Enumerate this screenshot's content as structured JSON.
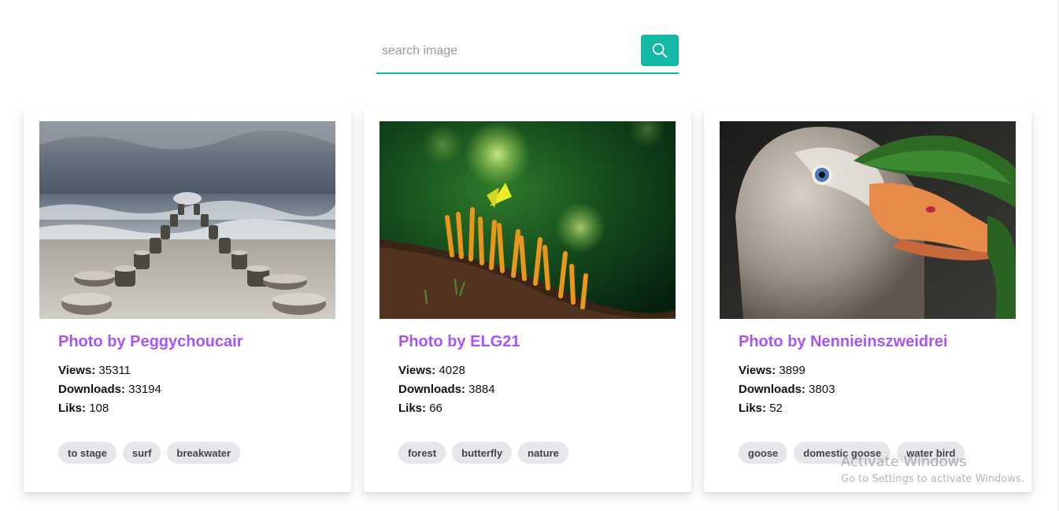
{
  "search": {
    "placeholder": "search image",
    "value": "",
    "button_icon": "search-icon",
    "accent": "#14b8a6"
  },
  "cards": [
    {
      "title": "Photo by Peggychoucair",
      "image_subject": "wooden breakwater posts leading into a stormy sea",
      "stats": {
        "views_label": "Views:",
        "views": "35311",
        "downloads_label": "Downloads:",
        "downloads": "33194",
        "likes_label": "Liks:",
        "likes": "108"
      },
      "tags": [
        "to stage",
        "surf",
        "breakwater"
      ]
    },
    {
      "title": "Photo by ELG21",
      "image_subject": "yellow butterfly on orange coral fungus in a green forest",
      "stats": {
        "views_label": "Views:",
        "views": "4028",
        "downloads_label": "Downloads:",
        "downloads": "3884",
        "likes_label": "Liks:",
        "likes": "66"
      },
      "tags": [
        "forest",
        "butterfly",
        "nature"
      ]
    },
    {
      "title": "Photo by Nennieinszweidrei",
      "image_subject": "close-up of a domestic goose head with orange beak",
      "stats": {
        "views_label": "Views:",
        "views": "3899",
        "downloads_label": "Downloads:",
        "downloads": "3803",
        "likes_label": "Liks:",
        "likes": "52"
      },
      "tags": [
        "goose",
        "domestic goose",
        "water bird"
      ]
    }
  ],
  "colors": {
    "title": "#a855f7",
    "tag_bg": "#e5e7eb"
  },
  "watermark": {
    "line1": "Activate Windows",
    "line2": "Go to Settings to activate Windows."
  }
}
